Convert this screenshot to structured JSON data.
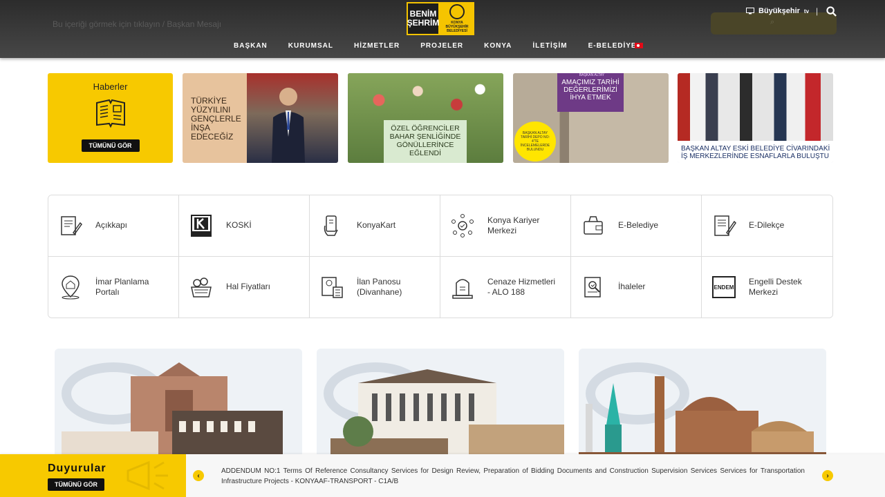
{
  "header": {
    "ghost_text": "Bu içeriği görmek için tıklayın / Başkan Mesajı",
    "nav": [
      "BAŞKAN",
      "KURUMSAL",
      "HİZMETLER",
      "PROJELER",
      "KONYA",
      "İLETİŞİM",
      "E-BELEDİYE"
    ],
    "logo_left": "BENİM ŞEHRİM",
    "logo_right": "KONYA BÜYÜKŞEHİR BELEDİYESİ",
    "tv_label": "Büyükşehir",
    "tv_suffix": "tv",
    "separator": "|"
  },
  "news": {
    "title": "Haberler",
    "see_all": "TÜMÜNÜ GÖR",
    "cards": [
      {
        "text": "TÜRKİYE YÜZYILINI GENÇLERLE İNŞA EDECEĞİZ"
      },
      {
        "text": "ÖZEL ÖĞRENCİLER BAHAR ŞENLİĞİNDE GÖNÜLLERİNCE EĞLENDİ"
      },
      {
        "text": "AMAÇIMIZ TARİHİ DEĞERLERİMİZİ İHYA ETMEK",
        "sub": "BAŞKAN ALTAY",
        "badge": "BAŞKAN ALTAY TARİHİ DEPO NO: 4'TE İNCELEMELERDE BULUNDU"
      },
      {
        "text": "BAŞKAN ALTAY ESKİ BELEDİYE CİVARINDAKİ İŞ MERKEZLERİNDE ESNAFLARLA BULUŞTU"
      }
    ]
  },
  "services": [
    {
      "label": "Açıkkapı",
      "icon": "document-pen-icon"
    },
    {
      "label": "KOSKİ",
      "icon": "koski-logo-icon"
    },
    {
      "label": "KonyaKart",
      "icon": "card-hand-icon"
    },
    {
      "label": "Konya Kariyer Merkezi",
      "icon": "network-people-icon"
    },
    {
      "label": "E-Belediye",
      "icon": "wallet-hand-icon"
    },
    {
      "label": "E-Dilekçe",
      "icon": "petition-pen-icon"
    },
    {
      "label": "İmar Planlama Portalı",
      "icon": "map-pin-house-icon"
    },
    {
      "label": "Hal Fiyatları",
      "icon": "produce-basket-icon"
    },
    {
      "label": "İlan Panosu (Divanhane)",
      "icon": "board-calculator-icon"
    },
    {
      "label": "Cenaze Hizmetleri - ALO 188",
      "icon": "tombstone-icon"
    },
    {
      "label": "İhaleler",
      "icon": "tender-document-icon"
    },
    {
      "label": "Engelli Destek Merkezi",
      "icon": "endem-logo-icon"
    }
  ],
  "announcements": {
    "title": "Duyurular",
    "see_all": "TÜMÜNÜ GÖR",
    "text": "ADDENDUM NO:1 Terms Of Reference Consultancy Services for Design Review, Preparation of Bidding Documents and Construction Supervision Services Services for Transportation Infrastructure Projects - KONYAAF-TRANSPORT - C1A/B",
    "prev": "‹",
    "next": "›"
  },
  "colors": {
    "accent": "#f7c900",
    "header": "#3a3a3a"
  }
}
